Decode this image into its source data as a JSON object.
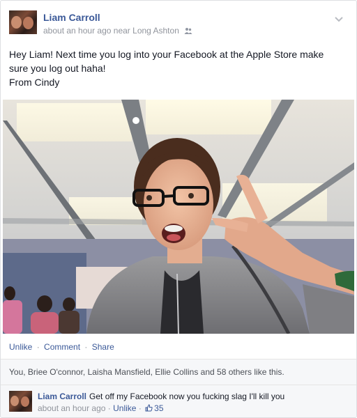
{
  "post": {
    "author": "Liam Carroll",
    "time": "about an hour ago",
    "near_label": "near",
    "place": "Long Ashton",
    "audience_icon": "friends-icon",
    "menu_icon": "chevron-down-icon",
    "message_lines": [
      "Hey Liam! Next time you log into your Facebook at the Apple Store make",
      "sure you log out haha!",
      "From Cindy"
    ]
  },
  "actions": {
    "unlike": "Unlike",
    "comment": "Comment",
    "share": "Share",
    "separator": "·"
  },
  "likes": {
    "text": "You, Briee O'connor, Laisha Mansfield, Ellie Collins and 58 others like this."
  },
  "comment": {
    "author": "Liam Carroll",
    "text": "Get off my Facebook now you fucking slag I'll kill you",
    "time": "about an hour ago",
    "unlike": "Unlike",
    "separator": "·",
    "like_icon": "thumbs-up-icon",
    "like_count": "35"
  },
  "colors": {
    "link": "#3b5998",
    "meta": "#90949c",
    "text": "#141823",
    "panel": "#f6f7f9"
  }
}
